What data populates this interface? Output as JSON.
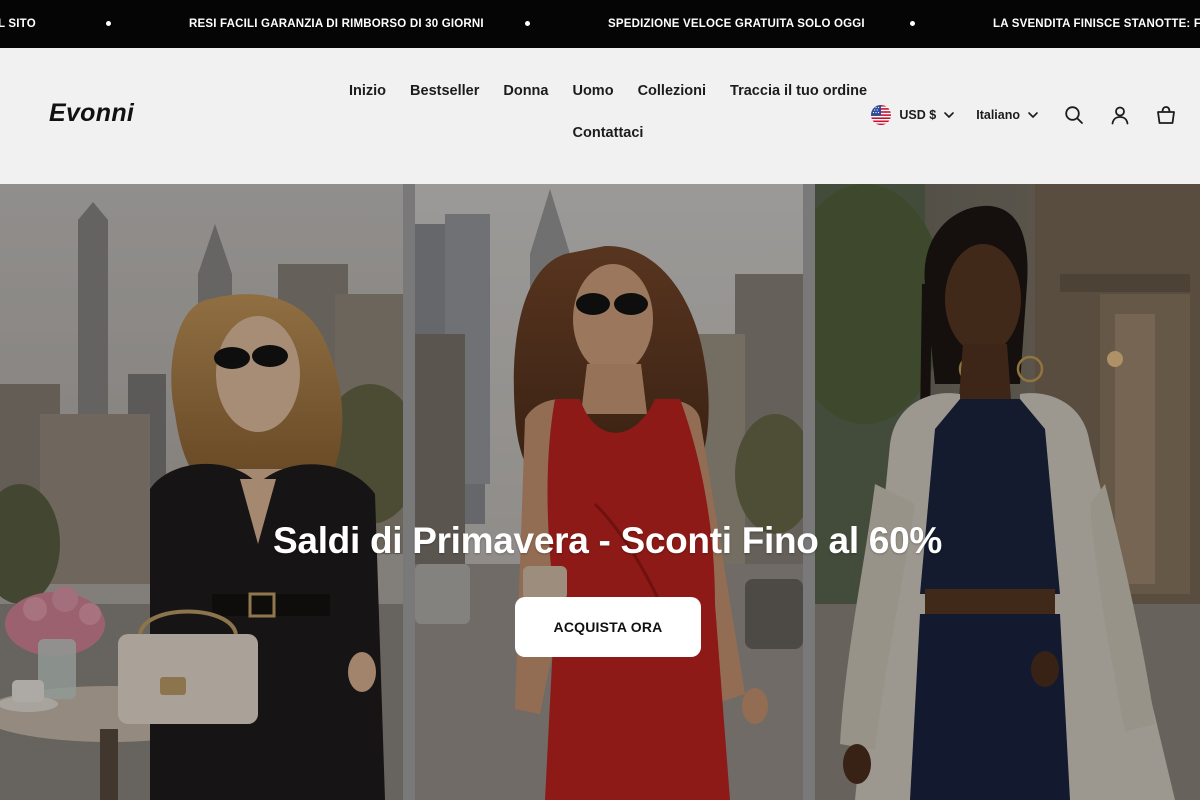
{
  "announcement": {
    "items": [
      "L SITO",
      "RESI FACILI GARANZIA DI RIMBORSO DI 30 GIORNI",
      "SPEDIZIONE VELOCE GRATUITA SOLO OGGI",
      "LA SVENDITA FINISCE STANOTTE: FIN"
    ],
    "background": "#050505",
    "text_color": "#ffffff"
  },
  "header": {
    "logo": "Evonni",
    "nav": [
      "Inizio",
      "Bestseller",
      "Donna",
      "Uomo",
      "Collezioni",
      "Traccia il tuo ordine",
      "Contattaci"
    ],
    "currency": "USD $",
    "language": "Italiano",
    "icons": [
      "search-icon",
      "account-icon",
      "cart-icon"
    ],
    "background": "#f1f1f1"
  },
  "hero": {
    "title": "Saldi di Primavera - Sconti Fino al 60%",
    "button": "ACQUISTA ORA",
    "panels": [
      "woman-black-blazer",
      "woman-red-dress",
      "woman-trench-coat"
    ]
  }
}
